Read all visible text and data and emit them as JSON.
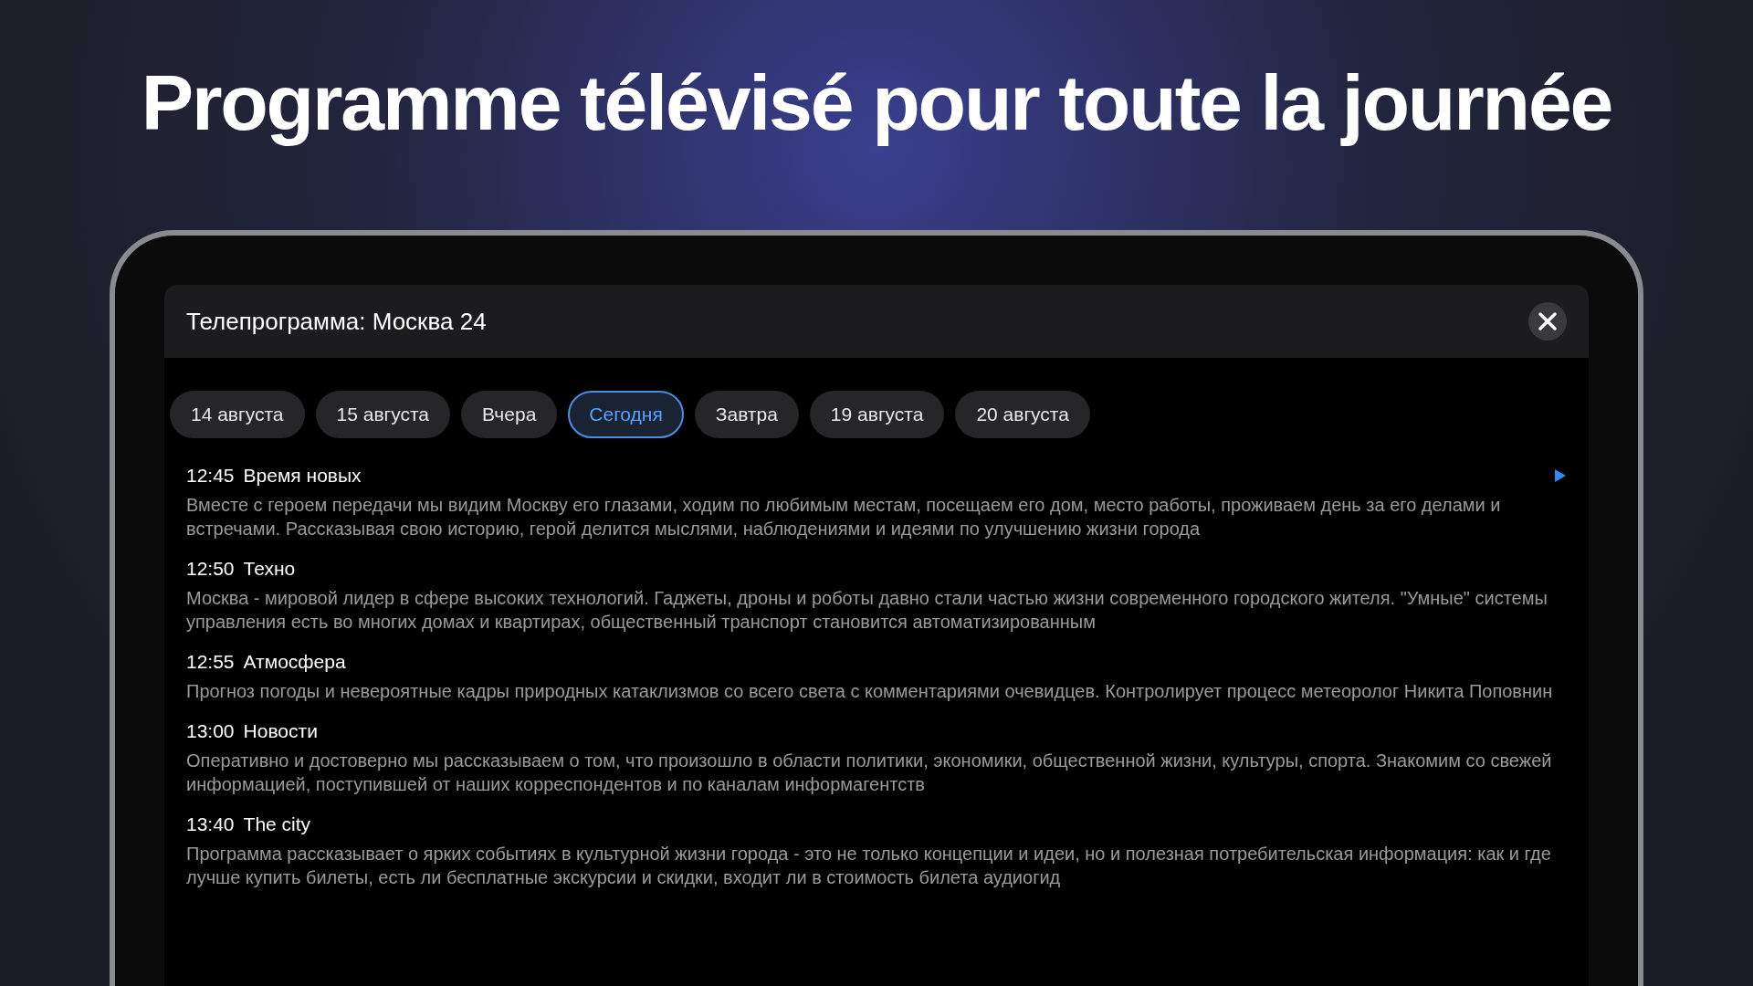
{
  "headline": "Programme télévisé pour toute la journée",
  "dialog": {
    "title": "Телепрограмма: Москва 24"
  },
  "tabs": [
    {
      "label": "14 августа",
      "selected": false
    },
    {
      "label": "15 августа",
      "selected": false
    },
    {
      "label": "Вчера",
      "selected": false
    },
    {
      "label": "Сегодня",
      "selected": true
    },
    {
      "label": "Завтра",
      "selected": false
    },
    {
      "label": "19 августа",
      "selected": false
    },
    {
      "label": "20 августа",
      "selected": false
    }
  ],
  "programs": [
    {
      "time": "12:45",
      "title": "Время новых",
      "now_playing": true,
      "description": "Вместе с героем передачи мы видим Москву его глазами, ходим по любимым местам, посещаем его дом, место работы, проживаем день за его делами и встречами. Рассказывая свою историю, герой делится мыслями, наблюдениями и идеями по улучшению жизни города"
    },
    {
      "time": "12:50",
      "title": "Техно",
      "now_playing": false,
      "description": "Москва - мировой лидер в сфере высоких технологий. Гаджеты, дроны и роботы давно стали частью жизни современного городского жителя. \"Умные\" системы управления есть во многих домах и квартирах, общественный транспорт становится автоматизированным"
    },
    {
      "time": "12:55",
      "title": "Атмосфера",
      "now_playing": false,
      "description": "Прогноз погоды и невероятные кадры природных катаклизмов со всего света с комментариями очевидцев. Контролирует процесс метеоролог Никита Поповнин"
    },
    {
      "time": "13:00",
      "title": "Новости",
      "now_playing": false,
      "description": "Оперативно и достоверно мы рассказываем о том, что произошло в области политики, экономики, общественной жизни, культуры, спорта. Знакомим со свежей информацией, поступившей от наших корреспондентов и по каналам информагентств"
    },
    {
      "time": "13:40",
      "title": "The city",
      "now_playing": false,
      "description": "Программа рассказывает о ярких событиях в культурной жизни города - это не только концепции и идеи, но и полезная потребительская информация: как и где лучше купить билеты, есть ли бесплатные экскурсии и скидки, входит ли в стоимость билета аудиогид"
    }
  ]
}
